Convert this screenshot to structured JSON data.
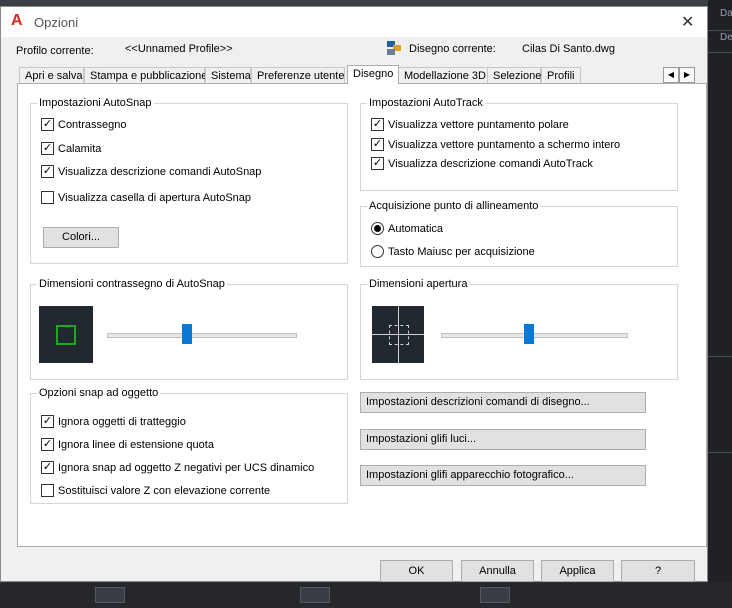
{
  "window": {
    "title": "Opzioni"
  },
  "profile": {
    "label": "Profilo corrente:",
    "value": "<<Unnamed Profile>>"
  },
  "drawing": {
    "label": "Disegno corrente:",
    "value": "Cilas Di Santo.dwg"
  },
  "tabs": [
    "Apri e salva",
    "Stampa e pubblicazione",
    "Sistema",
    "Preferenze utente",
    "Disegno",
    "Modellazione 3D",
    "Selezione",
    "Profili"
  ],
  "autosnap": {
    "title": "Impostazioni AutoSnap",
    "items": [
      {
        "label": "Contrassegno",
        "checked": true
      },
      {
        "label": "Calamita",
        "checked": true
      },
      {
        "label": "Visualizza descrizione comandi AutoSnap",
        "checked": true
      },
      {
        "label": "Visualizza casella di apertura AutoSnap",
        "checked": false
      }
    ],
    "colors_button": "Colori..."
  },
  "autotrack": {
    "title": "Impostazioni AutoTrack",
    "items": [
      {
        "label": "Visualizza vettore puntamento polare",
        "checked": true
      },
      {
        "label": "Visualizza vettore puntamento a schermo intero",
        "checked": true
      },
      {
        "label": "Visualizza descrizione comandi AutoTrack",
        "checked": true
      }
    ]
  },
  "alignment": {
    "title": "Acquisizione punto di allineamento",
    "options": [
      {
        "label": "Automatica",
        "selected": true
      },
      {
        "label": "Tasto Maiusc per acquisizione",
        "selected": false
      }
    ]
  },
  "marker_size": {
    "title": "Dimensioni contrassegno di AutoSnap"
  },
  "aperture_size": {
    "title": "Dimensioni apertura"
  },
  "osnap": {
    "title": "Opzioni snap ad oggetto",
    "items": [
      {
        "label": "Ignora oggetti di tratteggio",
        "checked": true
      },
      {
        "label": "Ignora linee di estensione quota",
        "checked": true
      },
      {
        "label": "Ignora snap ad oggetto Z negativi per UCS dinamico",
        "checked": true
      },
      {
        "label": "Sostituisci valore Z con elevazione corrente",
        "checked": false
      }
    ]
  },
  "buttons": {
    "tooltip_settings": "Impostazioni descrizioni comandi di disegno...",
    "light_glyph": "Impostazioni glifi luci...",
    "camera_glyph": "Impostazioni glifi apparecchio fotografico..."
  },
  "footer": {
    "ok": "OK",
    "cancel": "Annulla",
    "apply": "Applica",
    "help": "?"
  },
  "background": {
    "right_label_1": "Da",
    "right_label_2": "De"
  },
  "colors": {
    "accent": "#0a78d7",
    "marker_green": "#1fa81f",
    "preview_bg": "#212830"
  }
}
